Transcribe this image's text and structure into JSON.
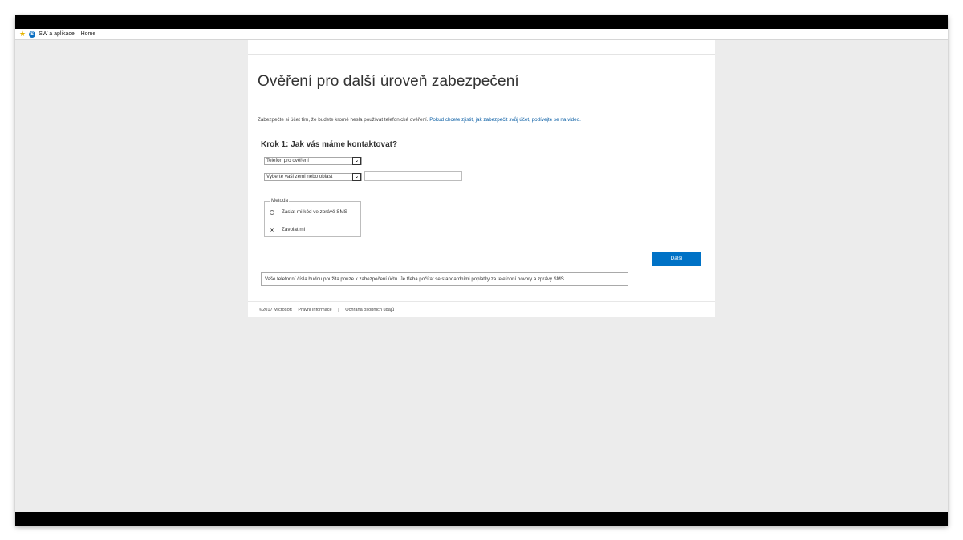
{
  "browser": {
    "tab_title": "SW a aplikace – Home",
    "tab_icon_letter": "S"
  },
  "page": {
    "title": "Ověření pro další úroveň zabezpečení",
    "intro_text": "Zabezpečte si účet tím, že budete kromě hesla používat telefonické ověření. ",
    "intro_link": "Pokud chcete zjistit, jak zabezpečit svůj účet, podívejte se na video.",
    "step_title": "Krok 1: Jak vás máme kontaktovat?",
    "contact_method_select": "Telefon pro ověření",
    "country_select": "Vyberte vaši zemi nebo oblast",
    "phone_input_value": "",
    "method": {
      "legend": "Metoda",
      "options": [
        {
          "label": "Zaslat mi kód ve zprávě SMS",
          "selected": false
        },
        {
          "label": "Zavolat mi",
          "selected": true
        }
      ]
    },
    "next_button": "Další",
    "notice": "Vaše telefonní čísla budou použita pouze k zabezpečení účtu. Je třeba počítat se standardními poplatky za telefonní hovory a zprávy SMS."
  },
  "footer": {
    "copyright": "©2017 Microsoft",
    "legal": "Právní informace",
    "separator": "|",
    "privacy": "Ochrana osobních údajů"
  },
  "colors": {
    "accent": "#0072c6",
    "link": "#0b5fa5",
    "frame": "#000000"
  }
}
